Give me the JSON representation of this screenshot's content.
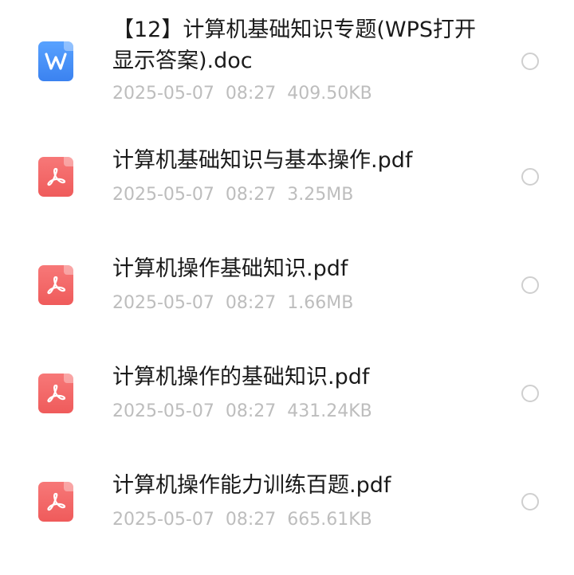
{
  "files": [
    {
      "name": "【12】计算机基础知识专题(WPS打开显示答案).doc",
      "icon": "word-doc-icon",
      "date": "2025-05-07",
      "time": "08:27",
      "size": "409.50KB"
    },
    {
      "name": "计算机基础知识与基本操作.pdf",
      "icon": "pdf-icon",
      "date": "2025-05-07",
      "time": "08:27",
      "size": "3.25MB"
    },
    {
      "name": "计算机操作基础知识.pdf",
      "icon": "pdf-icon",
      "date": "2025-05-07",
      "time": "08:27",
      "size": "1.66MB"
    },
    {
      "name": "计算机操作的基础知识.pdf",
      "icon": "pdf-icon",
      "date": "2025-05-07",
      "time": "08:27",
      "size": "431.24KB"
    },
    {
      "name": "计算机操作能力训练百题.pdf",
      "icon": "pdf-icon",
      "date": "2025-05-07",
      "time": "08:27",
      "size": "665.61KB"
    }
  ],
  "colors": {
    "word_icon": "#3b82f0",
    "pdf_icon": "#ef5b5b",
    "meta_text": "#bdbdbd"
  }
}
